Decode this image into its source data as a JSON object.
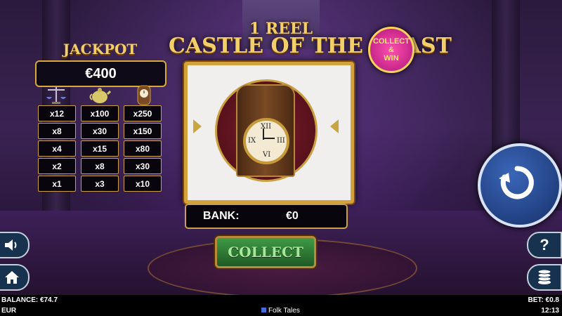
{
  "game": {
    "title_line1": "1 REEL",
    "title_line2": "CASTLE OF THE BEAST",
    "badge": [
      "COLLECT",
      "&",
      "WIN"
    ]
  },
  "jackpot": {
    "label": "JACKPOT",
    "value": "€400",
    "symbols": [
      "scales-icon",
      "teapot-icon",
      "clock-icon"
    ],
    "paytable": [
      [
        "x12",
        "x100",
        "x250"
      ],
      [
        "x8",
        "x30",
        "x150"
      ],
      [
        "x4",
        "x15",
        "x80"
      ],
      [
        "x2",
        "x8",
        "x30"
      ],
      [
        "x1",
        "x3",
        "x10"
      ]
    ]
  },
  "reel": {
    "symbol": "grandfather-clock-icon",
    "clock_numerals": [
      "XII",
      "III",
      "VI",
      "IX"
    ]
  },
  "bank": {
    "label": "BANK:",
    "value": "€0"
  },
  "buttons": {
    "collect": "COLLECT",
    "help": "?"
  },
  "footer": {
    "balance": "BALANCE: €74.7",
    "currency": "EUR",
    "brand": "Folk Tales",
    "bet": "BET: €0.8",
    "time": "12:13"
  },
  "colors": {
    "gold": "#d4a23a",
    "spin_blue": "#2a4f9a",
    "collect_green": "#2f7a36"
  }
}
